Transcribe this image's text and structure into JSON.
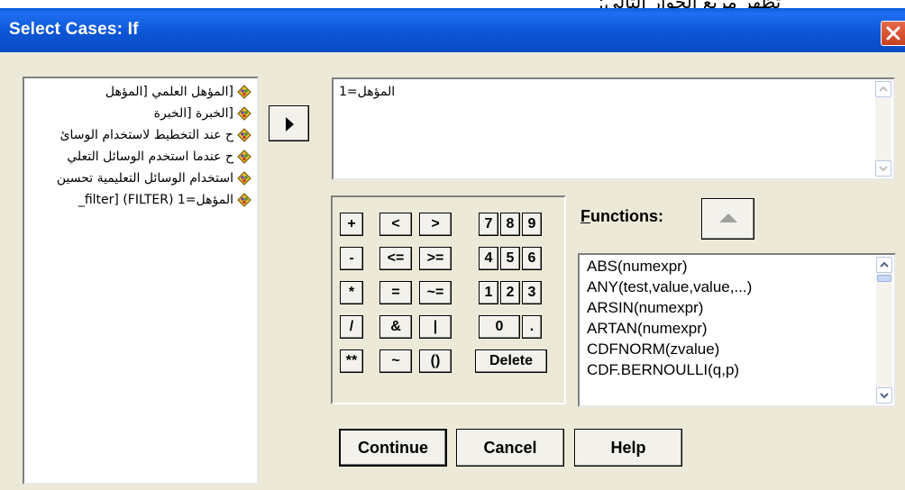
{
  "overlay_text": "تظهر مربع الحوار التالي:",
  "window": {
    "title": "Select Cases: If"
  },
  "variables": [
    {
      "label": "[المؤهل العلمي [المؤهل",
      "icon": "nominal-variable-icon"
    },
    {
      "label": "[الخبرة [الخبرة",
      "icon": "nominal-variable-icon"
    },
    {
      "label": "ح عند التخطيط لاستخدام الوسائ",
      "icon": "nominal-variable-icon"
    },
    {
      "label": "ح عندما استخدم الوسائل التعلي",
      "icon": "nominal-variable-icon"
    },
    {
      "label": "استخدام الوسائل التعليمية تحسين",
      "icon": "nominal-variable-icon"
    },
    {
      "label": "المؤهل=1 (FILTER) [filter_",
      "icon": "nominal-variable-icon"
    }
  ],
  "expression": "المؤهل=1",
  "keypad": {
    "keys": [
      "+",
      "<",
      ">",
      "7",
      "8",
      "9",
      "-",
      "<=",
      ">=",
      "4",
      "5",
      "6",
      "*",
      "=",
      "~=",
      "1",
      "2",
      "3",
      "/",
      "&",
      "|",
      "0",
      ".",
      "**",
      "~",
      "()",
      "Delete"
    ]
  },
  "functions": {
    "label_prefix": "",
    "label_underlined": "F",
    "label_rest": "unctions:",
    "items": [
      "ABS(numexpr)",
      "ANY(test,value,value,...)",
      "ARSIN(numexpr)",
      "ARTAN(numexpr)",
      "CDFNORM(zvalue)",
      "CDF.BERNOULLI(q,p)"
    ]
  },
  "buttons": {
    "continue": "Continue",
    "cancel": "Cancel",
    "help": "Help"
  }
}
